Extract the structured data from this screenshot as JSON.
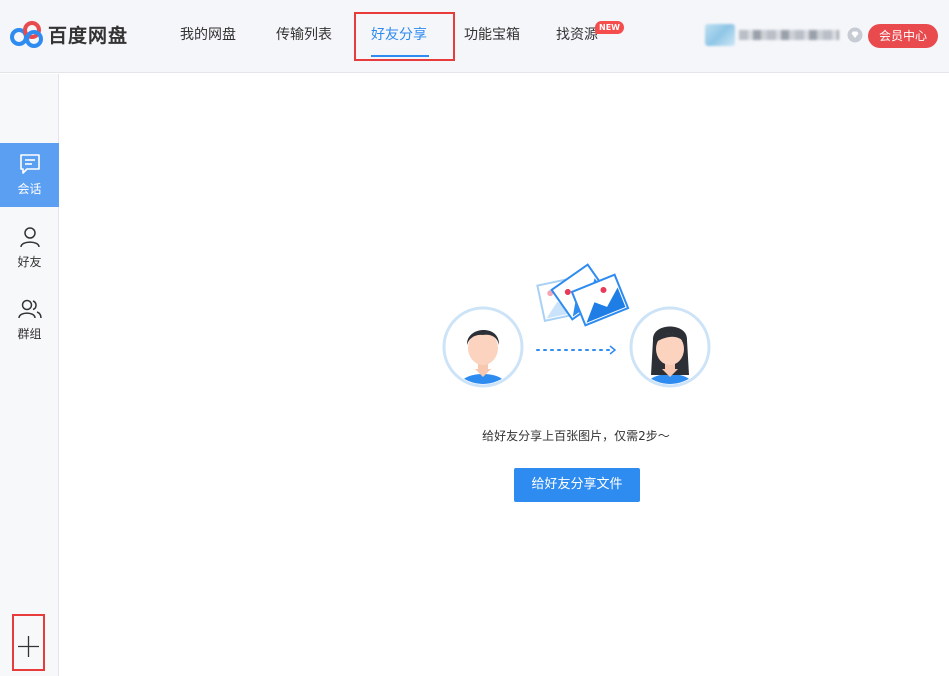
{
  "app": {
    "name": "百度网盘"
  },
  "nav": {
    "items": [
      {
        "label": "我的网盘"
      },
      {
        "label": "传输列表"
      },
      {
        "label": "好友分享"
      },
      {
        "label": "功能宝箱"
      },
      {
        "label": "找资源"
      }
    ],
    "new_badge": "NEW",
    "active_index": 2
  },
  "user": {
    "vip_label": "会员中心"
  },
  "sidebar": {
    "items": [
      {
        "label": "会话",
        "icon": "chat-icon"
      },
      {
        "label": "好友",
        "icon": "person-icon"
      },
      {
        "label": "群组",
        "icon": "group-icon"
      }
    ],
    "active_index": 0,
    "add_icon": "plus-icon"
  },
  "main": {
    "message": "给好友分享上百张图片，仅需2步～",
    "share_button": "给好友分享文件"
  },
  "colors": {
    "accent": "#2e8bf0",
    "vip": "#e84a4e",
    "highlight": "#e83b3b",
    "sidebar_active": "#5b9ff3"
  }
}
